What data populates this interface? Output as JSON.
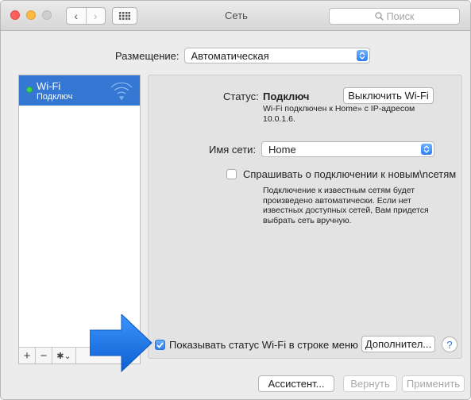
{
  "window": {
    "title": "Сеть"
  },
  "toolbar": {
    "back_glyph": "‹",
    "forward_glyph": "›",
    "search_placeholder": "Поиск"
  },
  "location": {
    "label": "Размещение:",
    "value": "Автоматическая"
  },
  "sidebar": {
    "items": [
      {
        "name": "Wi-Fi",
        "status": "Подключ",
        "status_color": "#3fd651",
        "icon": "wifi-icon"
      }
    ],
    "add_glyph": "+",
    "remove_glyph": "−",
    "gear_glyph": "✱⌄"
  },
  "details": {
    "status_label": "Статус:",
    "status_value": "Подключ",
    "wifi_off_button": "Выключить Wi-Fi",
    "status_description": "Wi-Fi подключен к Home» с IP-адресом 10.0.1.6.",
    "network_name_label": "Имя сети:",
    "network_name_value": "Home",
    "ask_to_join_label": "Спрашивать о подключении к новым\\nсетям",
    "ask_to_join_checked": false,
    "ask_to_join_description": "Подключение к известным сетям будет произведено автоматически. Если нет известных доступных сетей, Вам придется выбрать сеть вручную."
  },
  "footer": {
    "show_status_label": "Показывать статус Wi-Fi в строке меню",
    "show_status_checked": true,
    "advanced_button": "Дополнител...",
    "help_glyph": "?",
    "assistant_button": "Ассистент...",
    "revert_button": "Вернуть",
    "apply_button": "Применить"
  },
  "colors": {
    "accent": "#3478d4",
    "arrow": "#1f7be6"
  }
}
